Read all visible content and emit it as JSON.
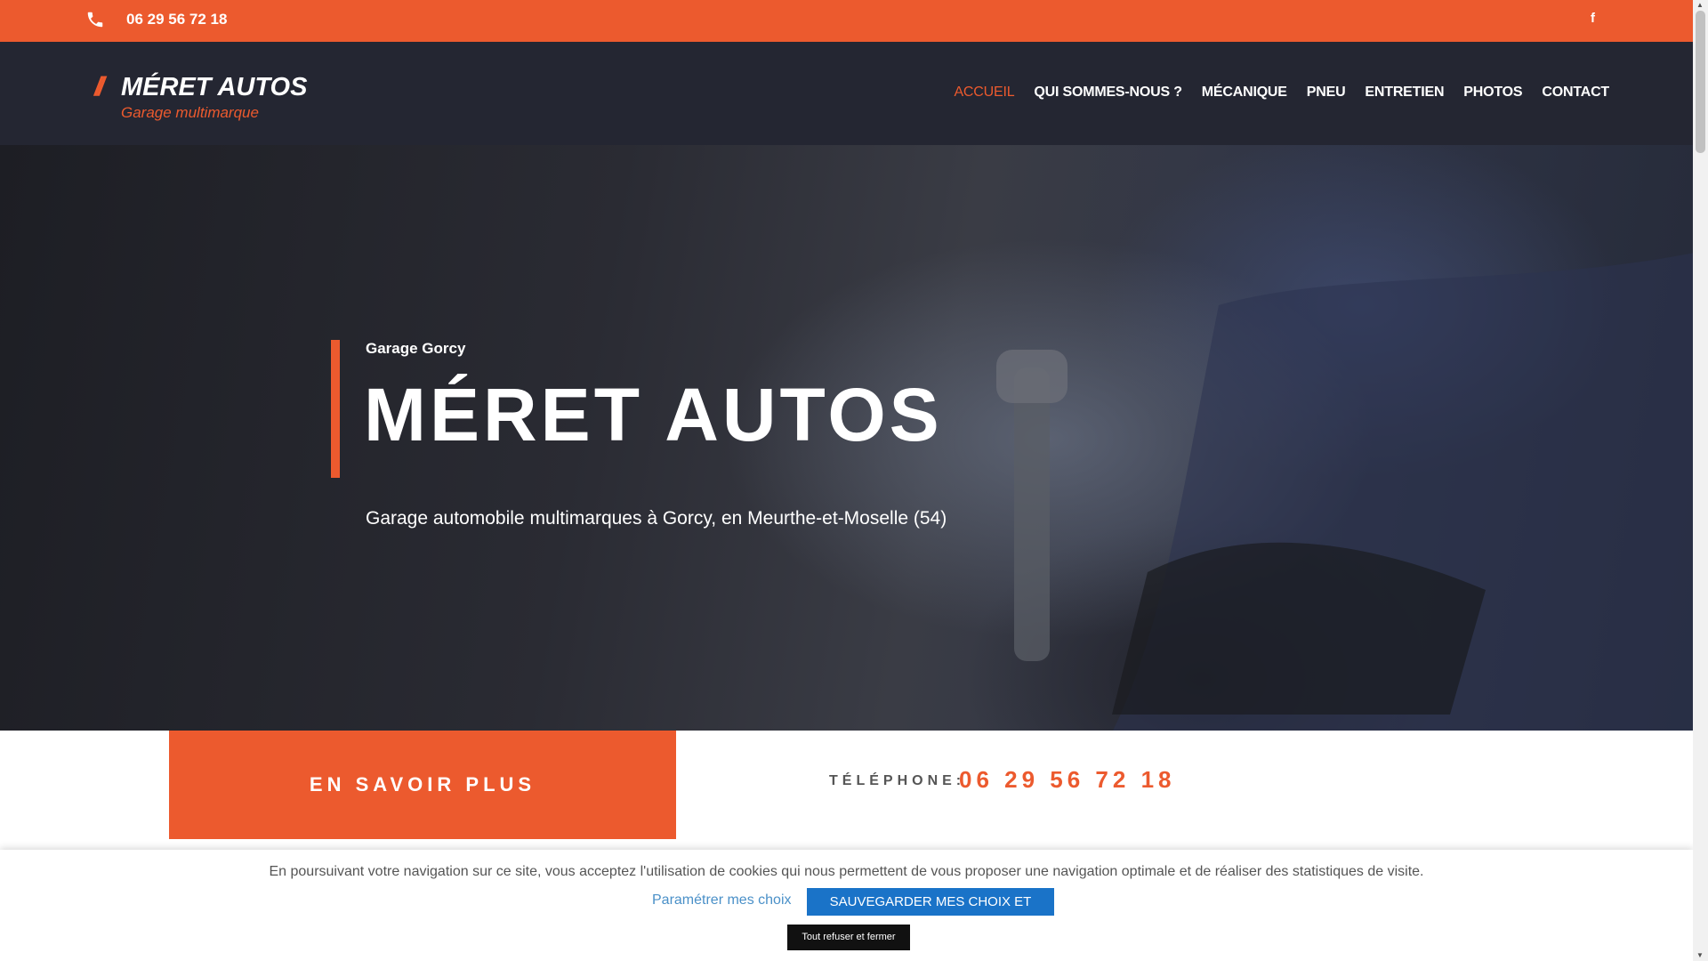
{
  "topbar": {
    "phone": "06 29 56 72 18",
    "facebook_label": "f",
    "icons": {
      "phone": "phone-icon",
      "facebook": "facebook-icon"
    }
  },
  "header": {
    "logo": {
      "slashes": "//",
      "name": "MÉRET AUTOS",
      "tagline": "Garage multimarque"
    },
    "nav": [
      {
        "label": "ACCUEIL",
        "active": true
      },
      {
        "label": "QUI SOMMES-NOUS ?",
        "active": false
      },
      {
        "label": "MÉCANIQUE",
        "active": false
      },
      {
        "label": "PNEU",
        "active": false
      },
      {
        "label": "ENTRETIEN",
        "active": false
      },
      {
        "label": "PHOTOS",
        "active": false
      },
      {
        "label": "CONTACT",
        "active": false
      }
    ]
  },
  "hero": {
    "kicker": "Garage Gorcy",
    "title": "MÉRET AUTOS",
    "subtitle": "Garage automobile multimarques à Gorcy, en Meurthe-et-Moselle (54)"
  },
  "cta": {
    "button_label": "EN SAVOIR PLUS",
    "phone_label": "TÉLÉPHONE:",
    "phone_number": "06 29 56 72 18"
  },
  "cookie": {
    "message": "En poursuivant votre navigation sur ce site, vous acceptez l'utilisation de cookies qui nous permettent de vous proposer une navigation optimale et de réaliser des statistiques de visite.",
    "settings_label": "Paramétrer mes choix",
    "save_label": "SAUVEGARDER MES CHOIX ET FERMER",
    "refuse_label": "Tout refuser et fermer"
  },
  "colors": {
    "accent": "#ec5a2e",
    "header_bg": "#242632",
    "save_button": "#1a73c8"
  }
}
